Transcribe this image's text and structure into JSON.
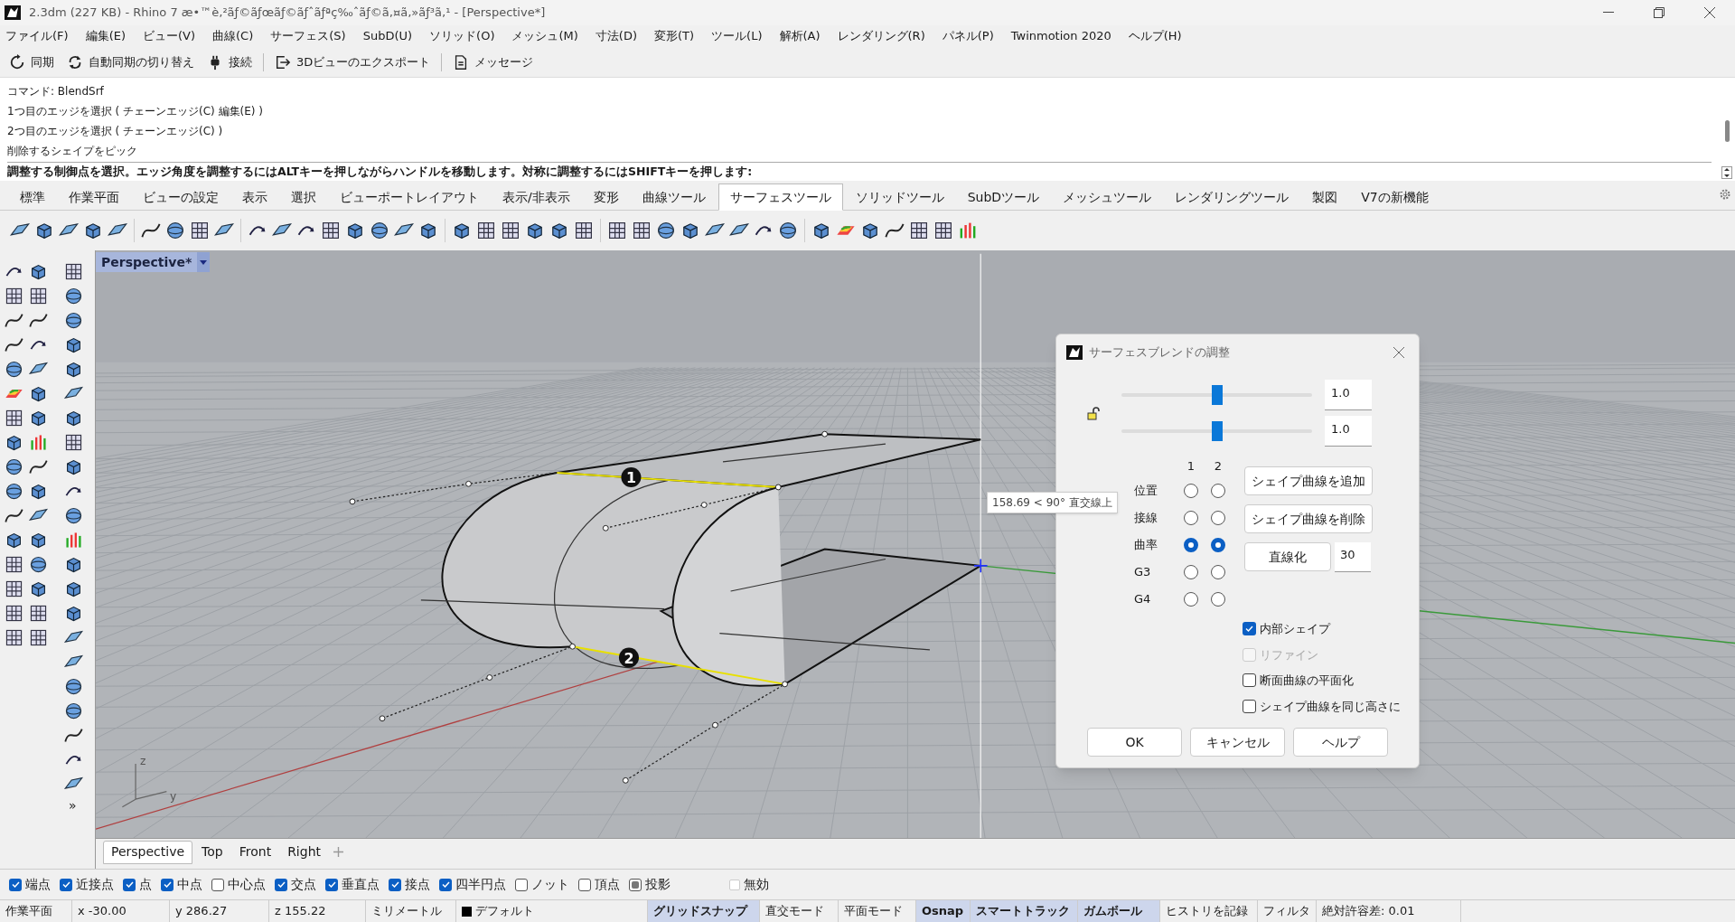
{
  "window": {
    "title": "2.3dm (227 KB) - Rhino 7 æ•™è‚²ãƒ©ãƒœãƒ©ãƒˆãƒªç‰ˆãƒ©ã‚¤ã‚»ãƒ³ã‚¹ - [Perspective*]"
  },
  "menu": [
    "ファイル(F)",
    "編集(E)",
    "ビュー(V)",
    "曲線(C)",
    "サーフェス(S)",
    "SubD(U)",
    "ソリッド(O)",
    "メッシュ(M)",
    "寸法(D)",
    "変形(T)",
    "ツール(L)",
    "解析(A)",
    "レンダリング(R)",
    "パネル(P)",
    "Twinmotion 2020",
    "ヘルプ(H)"
  ],
  "toolbar": [
    {
      "label": "同期",
      "kind": "sync"
    },
    {
      "label": "自動同期の切り替え",
      "kind": "autosync"
    },
    {
      "label": "接続",
      "kind": "plug"
    },
    {
      "label": "3Dビューのエクスポート",
      "kind": "export"
    },
    {
      "label": "メッセージ",
      "kind": "message"
    }
  ],
  "command": {
    "lines": [
      {
        "text": "コマンド: BlendSrf"
      },
      {
        "text": "1つ目のエッジを選択 ( チェーンエッジ(C) 編集(E) )"
      },
      {
        "text": "2つ目のエッジを選択 ( チェーンエッジ(C) )"
      },
      {
        "text": "削除するシェイプをピック"
      }
    ],
    "prompt": "調整する制御点を選択。エッジ角度を調整するにはALTキーを押しながらハンドルを移動します。対称に調整するにはSHIFTキーを押します:"
  },
  "ribbon_tabs": [
    {
      "label": "標準",
      "selected": false
    },
    {
      "label": "作業平面",
      "selected": false
    },
    {
      "label": "ビューの設定",
      "selected": false
    },
    {
      "label": "表示",
      "selected": false
    },
    {
      "label": "選択",
      "selected": false
    },
    {
      "label": "ビューポートレイアウト",
      "selected": false
    },
    {
      "label": "表示/非表示",
      "selected": false
    },
    {
      "label": "変形",
      "selected": false
    },
    {
      "label": "曲線ツール",
      "selected": false
    },
    {
      "label": "サーフェスツール",
      "selected": true
    },
    {
      "label": "ソリッドツール",
      "selected": false
    },
    {
      "label": "SubDツール",
      "selected": false
    },
    {
      "label": "メッシュツール",
      "selected": false
    },
    {
      "label": "レンダリングツール",
      "selected": false
    },
    {
      "label": "製図",
      "selected": false
    },
    {
      "label": "V7の新機能",
      "selected": false
    }
  ],
  "left_toolbar": {
    "overflow": "»"
  },
  "viewport": {
    "title": "Perspective*",
    "markers": [
      "1",
      "2"
    ],
    "tooltip": "158.69 < 90° 直交線上",
    "axis_labels": [
      "z",
      "y"
    ]
  },
  "dialog": {
    "title": "サーフェスブレンドの調整",
    "locked": false,
    "sliders": [
      {
        "level": 0.5,
        "value": "1.0"
      },
      {
        "level": 0.5,
        "value": "1.0"
      }
    ],
    "columns": [
      "1",
      "2"
    ],
    "rows": [
      {
        "label": "位置",
        "options": [
          {
            "selected": false
          },
          {
            "selected": false
          }
        ]
      },
      {
        "label": "接線",
        "options": [
          {
            "selected": false
          },
          {
            "selected": false
          }
        ]
      },
      {
        "label": "曲率",
        "options": [
          {
            "selected": true
          },
          {
            "selected": true
          }
        ]
      },
      {
        "label": "G3",
        "options": [
          {
            "selected": false
          },
          {
            "selected": false
          }
        ]
      },
      {
        "label": "G4",
        "options": [
          {
            "selected": false
          },
          {
            "selected": false
          }
        ]
      }
    ],
    "add_button": "シェイプ曲線を追加",
    "remove_button": "シェイプ曲線を削除",
    "straighten_button": "直線化",
    "straighten_value": "30",
    "checkboxes": [
      {
        "label": "内部シェイプ",
        "checked": true,
        "disabled": false
      },
      {
        "label": "リファイン",
        "checked": false,
        "disabled": true
      },
      {
        "label": "断面曲線の平面化",
        "checked": false,
        "disabled": false
      },
      {
        "label": "シェイプ曲線を同じ高さに",
        "checked": false,
        "disabled": false
      }
    ],
    "buttons": [
      "OK",
      "キャンセル",
      "ヘルプ"
    ]
  },
  "viewport_tabs": [
    {
      "label": "Perspective",
      "selected": true
    },
    {
      "label": "Top",
      "selected": false
    },
    {
      "label": "Front",
      "selected": false
    },
    {
      "label": "Right",
      "selected": false
    }
  ],
  "osnaps": [
    {
      "label": "端点",
      "checked": true,
      "kind": "check"
    },
    {
      "label": "近接点",
      "checked": true,
      "kind": "check"
    },
    {
      "label": "点",
      "checked": true,
      "kind": "check"
    },
    {
      "label": "中点",
      "checked": true,
      "kind": "check"
    },
    {
      "label": "中心点",
      "checked": false,
      "kind": "check"
    },
    {
      "label": "交点",
      "checked": true,
      "kind": "check"
    },
    {
      "label": "垂直点",
      "checked": true,
      "kind": "check"
    },
    {
      "label": "接点",
      "checked": true,
      "kind": "check"
    },
    {
      "label": "四半円点",
      "checked": true,
      "kind": "check"
    },
    {
      "label": "ノット",
      "checked": false,
      "kind": "check"
    },
    {
      "label": "頂点",
      "checked": false,
      "kind": "check"
    },
    {
      "label": "投影",
      "checked": true,
      "kind": "toggle"
    }
  ],
  "osnap_disable": {
    "label": "無効",
    "checked": false
  },
  "status_bar": [
    {
      "text": "作業平面",
      "active": false,
      "kind": "plain"
    },
    {
      "text": "x -30.00",
      "active": false,
      "kind": "plain"
    },
    {
      "text": "y 286.27",
      "active": false,
      "kind": "plain"
    },
    {
      "text": "z 155.22",
      "active": false,
      "kind": "plain"
    },
    {
      "text": "ミリメートル",
      "active": false,
      "kind": "plain"
    },
    {
      "text": "デフォルト",
      "active": false,
      "kind": "layer"
    },
    {
      "text": "グリッドスナップ",
      "active": true,
      "kind": "plain"
    },
    {
      "text": "直交モード",
      "active": false,
      "kind": "plain"
    },
    {
      "text": "平面モード",
      "active": false,
      "kind": "plain"
    },
    {
      "text": "Osnap",
      "active": true,
      "kind": "plain"
    },
    {
      "text": "スマートトラック",
      "active": true,
      "kind": "plain"
    },
    {
      "text": "ガムボール",
      "active": true,
      "kind": "plain"
    },
    {
      "text": "ヒストリを記録",
      "active": false,
      "kind": "plain"
    },
    {
      "text": "フィルタ",
      "active": false,
      "kind": "plain"
    },
    {
      "text": "絶対許容差: 0.01",
      "active": false,
      "kind": "plain"
    }
  ]
}
